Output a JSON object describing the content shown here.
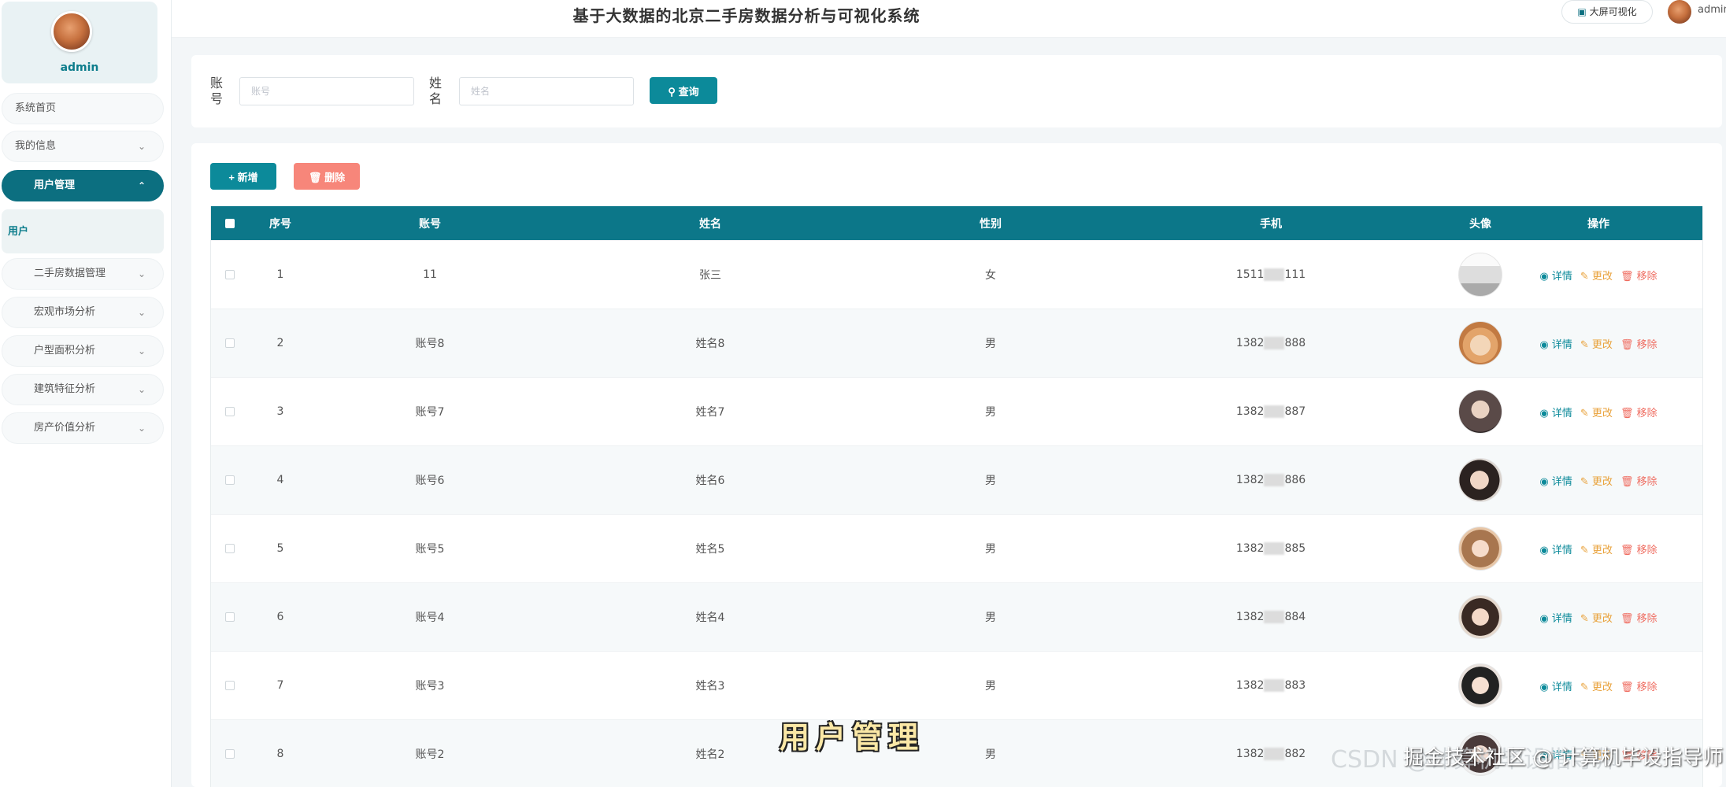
{
  "sidebar": {
    "username": "admin",
    "menu": {
      "home": "系统首页",
      "my_info": "我的信息",
      "user_mgmt": "用户管理",
      "user_sub": "用户",
      "house_data": "二手房数据管理",
      "macro": "宏观市场分析",
      "area": "户型面积分析",
      "building": "建筑特征分析",
      "value": "房产价值分析"
    }
  },
  "header": {
    "title": "基于大数据的北京二手房数据分析与可视化系统",
    "bigscreen_label": "大屏可视化",
    "user": "admin"
  },
  "search": {
    "account_label": "账号",
    "account_placeholder": "账号",
    "name_label": "姓名",
    "name_placeholder": "姓名",
    "query_label": "查询"
  },
  "actions": {
    "add_label": "新增",
    "delete_label": "删除"
  },
  "table": {
    "columns": [
      "序号",
      "账号",
      "姓名",
      "性别",
      "手机",
      "头像",
      "操作"
    ],
    "op_labels": {
      "detail": "详情",
      "edit": "更改",
      "remove": "移除"
    },
    "rows": [
      {
        "no": "1",
        "account": "11",
        "name": "张三",
        "gender": "女",
        "phone_a": "1511",
        "phone_b": "111"
      },
      {
        "no": "2",
        "account": "账号8",
        "name": "姓名8",
        "gender": "男",
        "phone_a": "1382",
        "phone_b": "888"
      },
      {
        "no": "3",
        "account": "账号7",
        "name": "姓名7",
        "gender": "男",
        "phone_a": "1382",
        "phone_b": "887"
      },
      {
        "no": "4",
        "account": "账号6",
        "name": "姓名6",
        "gender": "男",
        "phone_a": "1382",
        "phone_b": "886"
      },
      {
        "no": "5",
        "account": "账号5",
        "name": "姓名5",
        "gender": "男",
        "phone_a": "1382",
        "phone_b": "885"
      },
      {
        "no": "6",
        "account": "账号4",
        "name": "姓名4",
        "gender": "男",
        "phone_a": "1382",
        "phone_b": "884"
      },
      {
        "no": "7",
        "account": "账号3",
        "name": "姓名3",
        "gender": "男",
        "phone_a": "1382",
        "phone_b": "883"
      },
      {
        "no": "8",
        "account": "账号2",
        "name": "姓名2",
        "gender": "男",
        "phone_a": "1382",
        "phone_b": "882"
      }
    ]
  },
  "overlay": {
    "caption": "用户管理",
    "watermark_back": "CSDN @计算机毕设指导师",
    "watermark_front": "掘金技术社区 @ 计算机毕设指导师"
  },
  "colors": {
    "primary": "#0c7789",
    "accent": "#0c8a9a",
    "danger": "#f7867a",
    "edit": "#e9a23b"
  }
}
